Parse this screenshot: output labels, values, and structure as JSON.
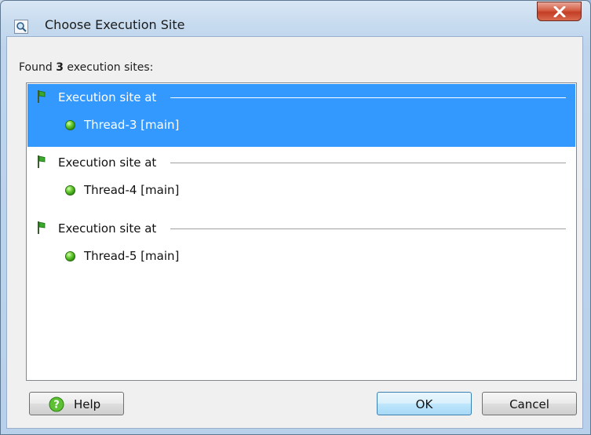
{
  "window": {
    "title": "Choose Execution Site",
    "title_icon": "magnifier-app-icon",
    "close_icon": "close-icon"
  },
  "dialog": {
    "found_prefix": "Found ",
    "found_count": "3",
    "found_suffix": " execution sites:",
    "sites": [
      {
        "label": "Execution site at",
        "thread": "Thread-3 [main]",
        "selected": true
      },
      {
        "label": "Execution site at",
        "thread": "Thread-4 [main]",
        "selected": false
      },
      {
        "label": "Execution site at",
        "thread": "Thread-5 [main]",
        "selected": false
      }
    ]
  },
  "buttons": {
    "help": "Help",
    "ok": "OK",
    "cancel": "Cancel"
  },
  "colors": {
    "selection": "#3399ff",
    "thread_dot": "#4fbf1f",
    "flag": "#2e8b1e",
    "close_button": "#c8452c"
  },
  "icons": {
    "site": "flag-icon",
    "thread": "green-dot-icon",
    "help": "help-icon"
  }
}
